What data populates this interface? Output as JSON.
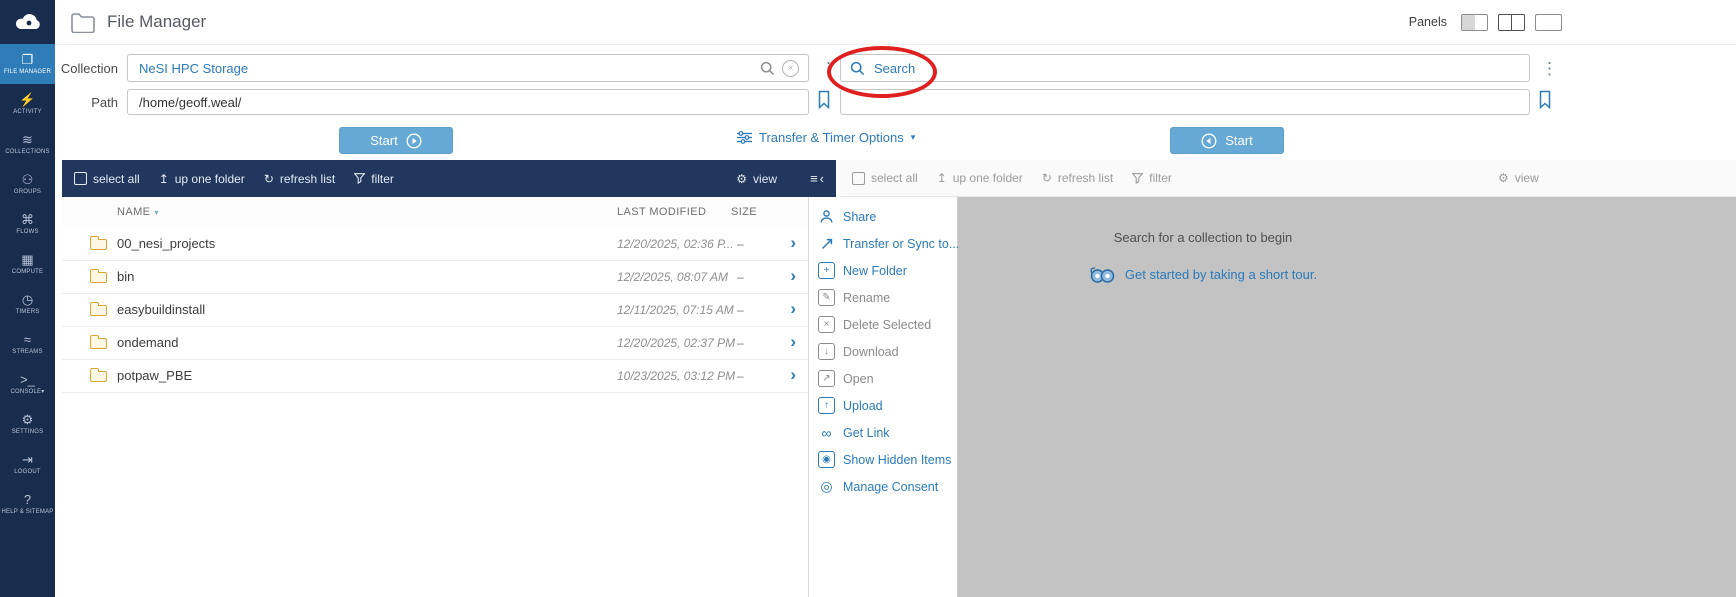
{
  "app": {
    "title": "File Manager",
    "panels_label": "Panels"
  },
  "sidebar": {
    "items": [
      {
        "label": "FILE MANAGER",
        "glyph": "❐",
        "active": true
      },
      {
        "label": "ACTIVITY",
        "glyph": "⚡",
        "active": false
      },
      {
        "label": "COLLECTIONS",
        "glyph": "≋",
        "active": false
      },
      {
        "label": "GROUPS",
        "glyph": "⚇",
        "active": false
      },
      {
        "label": "FLOWS",
        "glyph": "⌘",
        "active": false
      },
      {
        "label": "COMPUTE",
        "glyph": "▦",
        "active": false
      },
      {
        "label": "TIMERS",
        "glyph": "◷",
        "active": false
      },
      {
        "label": "STREAMS",
        "glyph": "≈",
        "active": false
      },
      {
        "label": "CONSOLE",
        "glyph": ">_",
        "active": false
      },
      {
        "label": "SETTINGS",
        "glyph": "⚙",
        "active": false
      },
      {
        "label": "LOGOUT",
        "glyph": "⇥",
        "active": false
      },
      {
        "label": "HELP & SITEMAP",
        "glyph": "?",
        "active": false
      }
    ]
  },
  "toolbar_labels": {
    "select_all": "select all",
    "up_one_folder": "up one folder",
    "refresh_list": "refresh list",
    "filter": "filter",
    "view": "view"
  },
  "left_panel": {
    "collection_label": "Collection",
    "collection_value": "NeSI HPC Storage",
    "path_label": "Path",
    "path_value": "/home/geoff.weal/",
    "start_label": "Start",
    "columns": {
      "name": "NAME",
      "modified": "LAST MODIFIED",
      "size": "SIZE"
    },
    "rows": [
      {
        "name": "00_nesi_projects",
        "modified": "12/20/2025, 02:36 P...",
        "size": "–"
      },
      {
        "name": "bin",
        "modified": "12/2/2025, 08:07 AM",
        "size": "–"
      },
      {
        "name": "easybuildinstall",
        "modified": "12/11/2025, 07:15 AM",
        "size": "–"
      },
      {
        "name": "ondemand",
        "modified": "12/20/2025, 02:37 PM",
        "size": "–"
      },
      {
        "name": "potpaw_PBE",
        "modified": "10/23/2025, 03:12 PM",
        "size": "–"
      }
    ]
  },
  "transfer_options": {
    "label": "Transfer & Timer Options"
  },
  "right_panel": {
    "search_placeholder": "Search",
    "path_value": "",
    "start_label": "Start",
    "empty_message": "Search for a collection to begin",
    "tour_label": "Get started by taking a short tour."
  },
  "action_menu": {
    "items": [
      {
        "label": "Share",
        "enabled": true,
        "glyph": ""
      },
      {
        "label": "Transfer or Sync to...",
        "enabled": true,
        "glyph": ""
      },
      {
        "label": "New Folder",
        "enabled": true,
        "glyph": "+"
      },
      {
        "label": "Rename",
        "enabled": false,
        "glyph": "✎"
      },
      {
        "label": "Delete Selected",
        "enabled": false,
        "glyph": "×"
      },
      {
        "label": "Download",
        "enabled": false,
        "glyph": "↓"
      },
      {
        "label": "Open",
        "enabled": false,
        "glyph": "↗"
      },
      {
        "label": "Upload",
        "enabled": true,
        "glyph": "↑"
      },
      {
        "label": "Get Link",
        "enabled": true,
        "glyph": "∞"
      },
      {
        "label": "Show Hidden Items",
        "enabled": true,
        "glyph": "◉"
      },
      {
        "label": "Manage Consent",
        "enabled": true,
        "glyph": "◎"
      }
    ]
  },
  "icons": {
    "menu_dots": "⋮",
    "chevron_down": "▾",
    "chevron_right": "›",
    "chevron_left": "‹",
    "hamburger": "≡",
    "refresh": "↻",
    "up_folder": "↥",
    "gear": "⚙",
    "clear": "×",
    "sort": "▾"
  },
  "colors": {
    "sidebar_navy": "#182c4e",
    "toolbar_navy": "#22375e",
    "accent_blue": "#2b7bb9",
    "active_nav": "#2e7cb8",
    "start_button": "#66a9d4",
    "panel_gray": "#c3c3c3",
    "annotation_red": "#e02020",
    "folder_amber": "#d9a733"
  }
}
